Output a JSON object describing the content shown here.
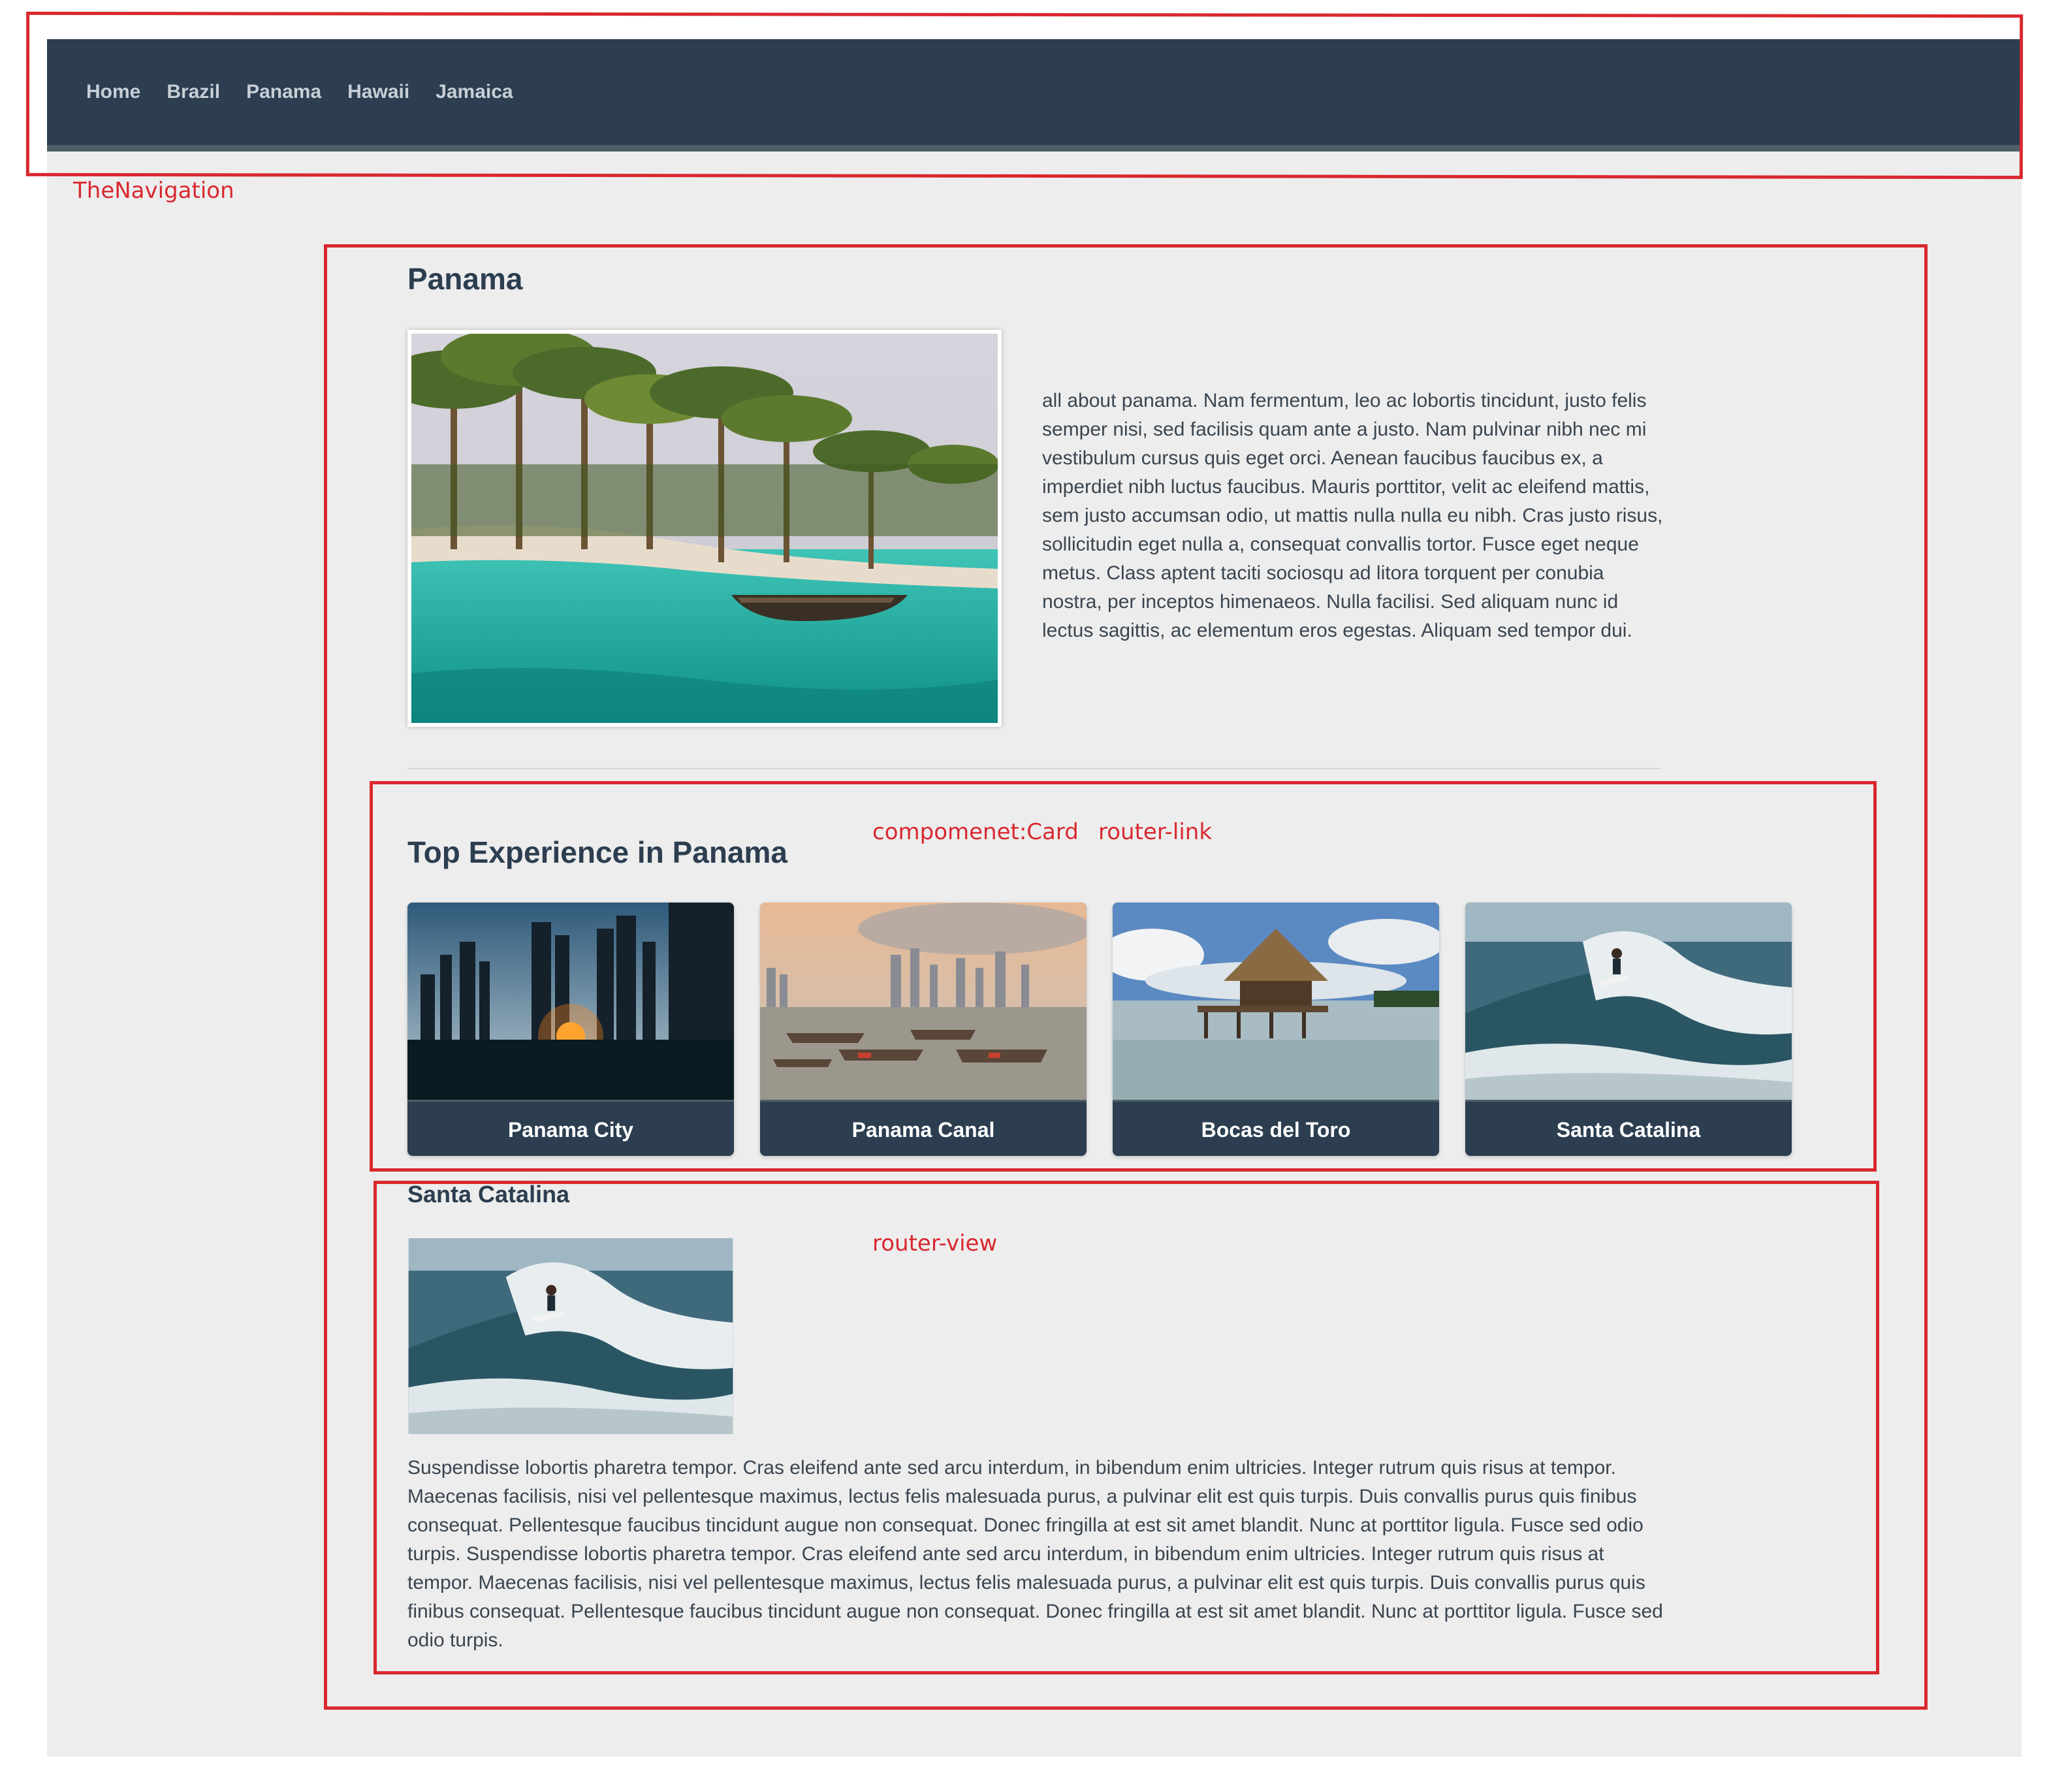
{
  "nav": {
    "links": [
      "Home",
      "Brazil",
      "Panama",
      "Hawaii",
      "Jamaica"
    ]
  },
  "annotations": {
    "navigation": "TheNavigation",
    "card": "compomenet:Card",
    "router_link": "router-link",
    "router_view": "router-view"
  },
  "destination": {
    "name": "Panama",
    "description": "all about panama. Nam fermentum, leo ac lobortis tincidunt, justo felis semper nisi, sed facilisis quam ante a justo. Nam pulvinar nibh nec mi vestibulum cursus quis eget orci. Aenean faucibus faucibus ex, a imperdiet nibh luctus faucibus. Mauris porttitor, velit ac eleifend mattis, sem justo accumsan odio, ut mattis nulla nulla eu nibh. Cras justo risus, sollicitudin eget nulla a, consequat convallis tortor. Fusce eget neque metus. Class aptent taciti sociosqu ad litora torquent per conubia nostra, per inceptos himenaeos. Nulla facilisi. Sed aliquam nunc id lectus sagittis, ac elementum eros egestas. Aliquam sed tempor dui."
  },
  "experiences": {
    "title": "Top Experience in Panama",
    "cards": [
      "Panama City",
      "Panama Canal",
      "Bocas del Toro",
      "Santa Catalina"
    ]
  },
  "experience_detail": {
    "title": "Santa Catalina",
    "description": "Suspendisse lobortis pharetra tempor. Cras eleifend ante sed arcu interdum, in bibendum enim ultricies. Integer rutrum quis risus at tempor. Maecenas facilisis, nisi vel pellentesque maximus, lectus felis malesuada purus, a pulvinar elit est quis turpis. Duis convallis purus quis finibus consequat. Pellentesque faucibus tincidunt augue non consequat. Donec fringilla at est sit amet blandit. Nunc at porttitor ligula. Fusce sed odio turpis. Suspendisse lobortis pharetra tempor. Cras eleifend ante sed arcu interdum, in bibendum enim ultricies. Integer rutrum quis risus at tempor. Maecenas facilisis, nisi vel pellentesque maximus, lectus felis malesuada purus, a pulvinar elit est quis turpis. Duis convallis purus quis finibus consequat. Pellentesque faucibus tincidunt augue non consequat. Donec fringilla at est sit amet blandit. Nunc at porttitor ligula. Fusce sed odio turpis."
  },
  "colors": {
    "nav_bg": "#2c3e50",
    "page_bg": "#ededed",
    "annotation": "#d9282f"
  }
}
